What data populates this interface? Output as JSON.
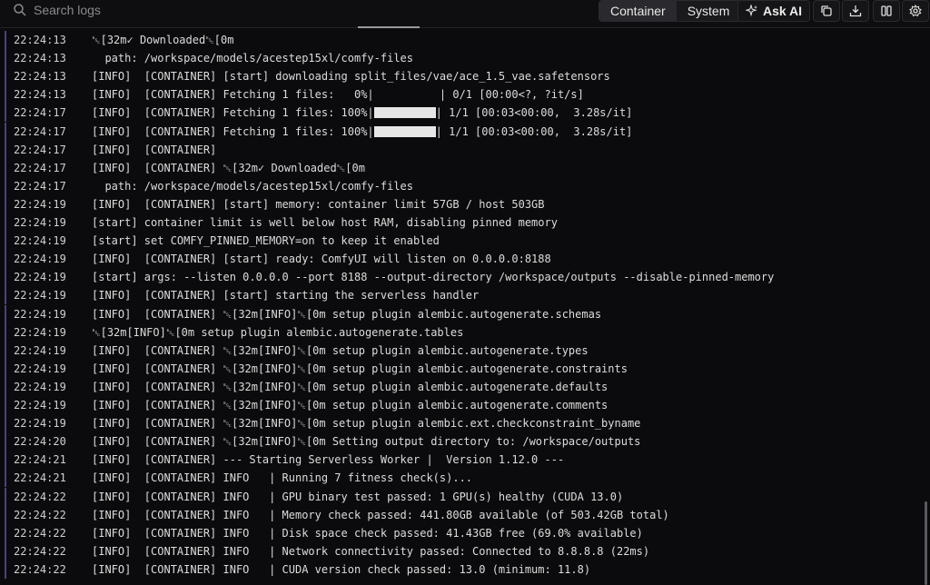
{
  "toolbar": {
    "search_placeholder": "Search logs",
    "tabs": [
      {
        "label": "Container",
        "active": true
      },
      {
        "label": "System",
        "active": false
      }
    ],
    "ask_ai_label": "Ask AI",
    "icons": [
      "copy-icon",
      "download-icon",
      "columns-icon",
      "settings-icon"
    ]
  },
  "colors": {
    "background": "#0b0b0d",
    "row_accent": "#4b3f86",
    "text": "#dcdcdc"
  },
  "logs": [
    {
      "ts": "22:24:13",
      "pre": "␛[32m✓ Downloaded␛[0m",
      "post": ""
    },
    {
      "ts": "22:24:13",
      "pre": "  path: /workspace/models/acestep15xl/comfy-files",
      "post": ""
    },
    {
      "ts": "22:24:13",
      "pre": "[INFO]  [CONTAINER] [start] downloading split_files/vae/ace_1.5_vae.safetensors",
      "post": ""
    },
    {
      "ts": "22:24:13",
      "pre": "[INFO]  [CONTAINER] Fetching 1 files:   0%|          | 0/1 [00:00<?, ?it/s]",
      "post": ""
    },
    {
      "ts": "22:24:17",
      "pre": "[INFO]  [CONTAINER] Fetching 1 files: 100%|",
      "post": "| 1/1 [00:03<00:00,  3.28s/it]",
      "progress": 1.0
    },
    {
      "ts": "22:24:17",
      "pre": "[INFO]  [CONTAINER] Fetching 1 files: 100%|",
      "post": "| 1/1 [00:03<00:00,  3.28s/it]",
      "progress": 1.0
    },
    {
      "ts": "22:24:17",
      "pre": "[INFO]  [CONTAINER]",
      "post": ""
    },
    {
      "ts": "22:24:17",
      "pre": "[INFO]  [CONTAINER] ␛[32m✓ Downloaded␛[0m",
      "post": ""
    },
    {
      "ts": "22:24:17",
      "pre": "  path: /workspace/models/acestep15xl/comfy-files",
      "post": ""
    },
    {
      "ts": "22:24:19",
      "pre": "[INFO]  [CONTAINER] [start] memory: container limit 57GB / host 503GB",
      "post": ""
    },
    {
      "ts": "22:24:19",
      "pre": "[start] container limit is well below host RAM, disabling pinned memory",
      "post": ""
    },
    {
      "ts": "22:24:19",
      "pre": "[start] set COMFY_PINNED_MEMORY=on to keep it enabled",
      "post": ""
    },
    {
      "ts": "22:24:19",
      "pre": "[INFO]  [CONTAINER] [start] ready: ComfyUI will listen on 0.0.0.0:8188",
      "post": ""
    },
    {
      "ts": "22:24:19",
      "pre": "[start] args: --listen 0.0.0.0 --port 8188 --output-directory /workspace/outputs --disable-pinned-memory",
      "post": ""
    },
    {
      "ts": "22:24:19",
      "pre": "[INFO]  [CONTAINER] [start] starting the serverless handler",
      "post": ""
    },
    {
      "ts": "22:24:19",
      "pre": "[INFO]  [CONTAINER] ␛[32m[INFO]␛[0m setup plugin alembic.autogenerate.schemas",
      "post": ""
    },
    {
      "ts": "22:24:19",
      "pre": "␛[32m[INFO]␛[0m setup plugin alembic.autogenerate.tables",
      "post": ""
    },
    {
      "ts": "22:24:19",
      "pre": "[INFO]  [CONTAINER] ␛[32m[INFO]␛[0m setup plugin alembic.autogenerate.types",
      "post": ""
    },
    {
      "ts": "22:24:19",
      "pre": "[INFO]  [CONTAINER] ␛[32m[INFO]␛[0m setup plugin alembic.autogenerate.constraints",
      "post": ""
    },
    {
      "ts": "22:24:19",
      "pre": "[INFO]  [CONTAINER] ␛[32m[INFO]␛[0m setup plugin alembic.autogenerate.defaults",
      "post": ""
    },
    {
      "ts": "22:24:19",
      "pre": "[INFO]  [CONTAINER] ␛[32m[INFO]␛[0m setup plugin alembic.autogenerate.comments",
      "post": ""
    },
    {
      "ts": "22:24:19",
      "pre": "[INFO]  [CONTAINER] ␛[32m[INFO]␛[0m setup plugin alembic.ext.checkconstraint_byname",
      "post": ""
    },
    {
      "ts": "22:24:20",
      "pre": "[INFO]  [CONTAINER] ␛[32m[INFO]␛[0m Setting output directory to: /workspace/outputs",
      "post": ""
    },
    {
      "ts": "22:24:21",
      "pre": "[INFO]  [CONTAINER] --- Starting Serverless Worker |  Version 1.12.0 ---",
      "post": ""
    },
    {
      "ts": "22:24:21",
      "pre": "[INFO]  [CONTAINER] INFO   | Running 7 fitness check(s)...",
      "post": ""
    },
    {
      "ts": "22:24:22",
      "pre": "[INFO]  [CONTAINER] INFO   | GPU binary test passed: 1 GPU(s) healthy (CUDA 13.0)",
      "post": ""
    },
    {
      "ts": "22:24:22",
      "pre": "[INFO]  [CONTAINER] INFO   | Memory check passed: 441.80GB available (of 503.42GB total)",
      "post": ""
    },
    {
      "ts": "22:24:22",
      "pre": "[INFO]  [CONTAINER] INFO   | Disk space check passed: 41.43GB free (69.0% available)",
      "post": ""
    },
    {
      "ts": "22:24:22",
      "pre": "[INFO]  [CONTAINER] INFO   | Network connectivity passed: Connected to 8.8.8.8 (22ms)",
      "post": ""
    },
    {
      "ts": "22:24:22",
      "pre": "[INFO]  [CONTAINER] INFO   | CUDA version check passed: 13.0 (minimum: 11.8)",
      "post": ""
    }
  ]
}
